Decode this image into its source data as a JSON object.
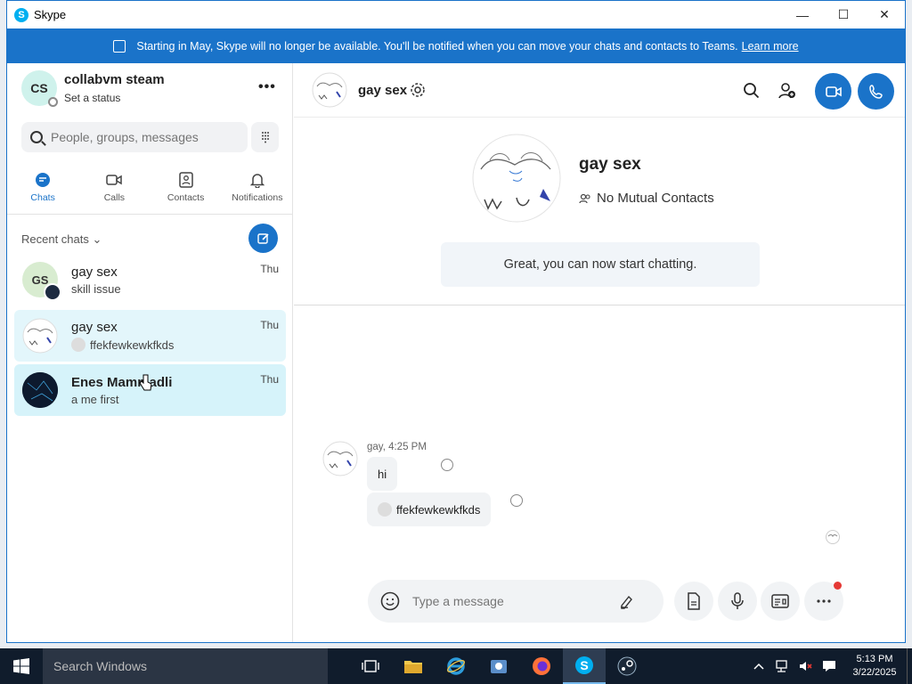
{
  "window": {
    "title": "Skype",
    "minimize": "—",
    "maximize": "☐",
    "close": "✕"
  },
  "banner": {
    "text": "Starting in May, Skype will no longer be available. You'll be notified when you can move your chats and contacts to Teams.",
    "link": "Learn more"
  },
  "profile": {
    "initials": "CS",
    "name": "collabvm steam",
    "status": "Set a status",
    "more": "•••"
  },
  "search": {
    "placeholder": "People, groups, messages"
  },
  "nav": [
    {
      "label": "Chats",
      "icon": "chat-icon"
    },
    {
      "label": "Calls",
      "icon": "video-icon"
    },
    {
      "label": "Contacts",
      "icon": "contacts-icon"
    },
    {
      "label": "Notifications",
      "icon": "bell-icon"
    }
  ],
  "recent": {
    "header": "Recent chats ⌄"
  },
  "chats": [
    {
      "initials": "GS",
      "name": "gay sex",
      "last": "skill issue",
      "time": "Thu"
    },
    {
      "name": "gay sex",
      "last": "ffekfewkewkfkds",
      "time": "Thu"
    },
    {
      "name": "Enes Mammadli",
      "last": "a me first",
      "time": "Thu"
    }
  ],
  "conversation": {
    "name": "gay sex",
    "intro_name": "gay sex",
    "mutual": "No Mutual Contacts",
    "start_text": "Great, you can now start chatting.",
    "meta": "gay, 4:25 PM",
    "messages": [
      "hi",
      "ffekfewkewkfkds"
    ],
    "composer_placeholder": "Type a message"
  },
  "taskbar": {
    "search": "Search Windows",
    "time": "5:13 PM",
    "date": "3/22/2025"
  },
  "colors": {
    "accent": "#1a73c9",
    "banner": "#1a73c9",
    "selected": "#e3f6fb",
    "taskbar": "#101c2c"
  }
}
